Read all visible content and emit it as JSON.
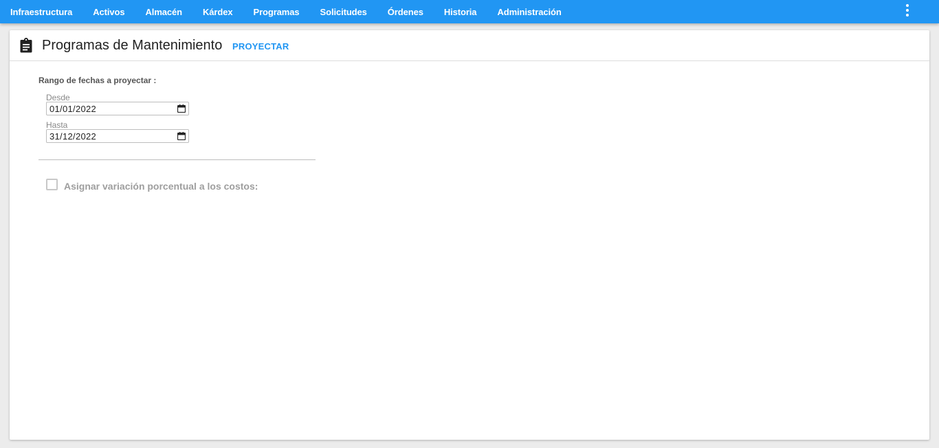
{
  "nav": {
    "items": [
      {
        "label": "Infraestructura"
      },
      {
        "label": "Activos"
      },
      {
        "label": "Almacén"
      },
      {
        "label": "Kárdex"
      },
      {
        "label": "Programas"
      },
      {
        "label": "Solicitudes"
      },
      {
        "label": "Órdenes"
      },
      {
        "label": "Historia"
      },
      {
        "label": "Administración"
      }
    ],
    "menu_icon": "more-vert-icon",
    "background_color": "#2196f3"
  },
  "header": {
    "icon": "clipboard-icon",
    "title": "Programas de Mantenimiento",
    "action_label": "PROYECTAR",
    "action_color": "#2196f3"
  },
  "form": {
    "range_label": "Rango de fechas a proyectar :",
    "from": {
      "label": "Desde",
      "value": "01/01/2022",
      "icon": "calendar-icon"
    },
    "to": {
      "label": "Hasta",
      "value": "31/12/2022",
      "icon": "calendar-icon"
    },
    "cost_variation": {
      "label": "Asignar variación porcentual a los costos:",
      "checked": false
    }
  }
}
